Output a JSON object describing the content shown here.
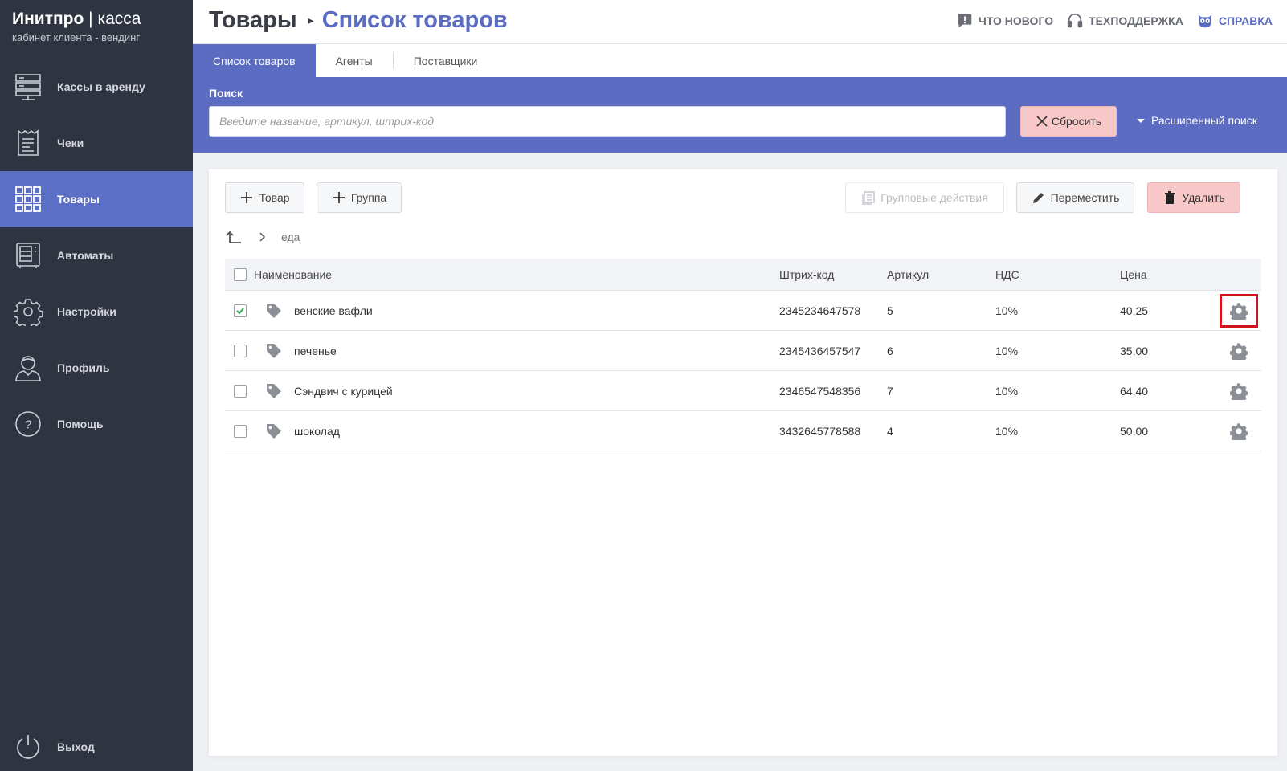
{
  "app": {
    "brand_bold": "Инитпро",
    "brand_sep": " | ",
    "brand_light": "касса",
    "subtitle": "кабинет клиента - вендинг"
  },
  "sidebar": {
    "items": [
      {
        "label": "Кассы в аренду",
        "icon": "server-icon"
      },
      {
        "label": "Чеки",
        "icon": "receipt-icon"
      },
      {
        "label": "Товары",
        "icon": "grid-icon"
      },
      {
        "label": "Автоматы",
        "icon": "vending-machine-icon"
      },
      {
        "label": "Настройки",
        "icon": "gear-icon"
      },
      {
        "label": "Профиль",
        "icon": "user-icon"
      },
      {
        "label": "Помощь",
        "icon": "question-icon"
      }
    ],
    "active_index": 2,
    "logout_label": "Выход"
  },
  "header": {
    "crumb_parent": "Товары",
    "crumb_current": "Список товаров",
    "links": {
      "whats_new": "ЧТО НОВОГО",
      "support": "ТЕХПОДДЕРЖКА",
      "help": "СПРАВКА"
    }
  },
  "tabs": {
    "items": [
      "Список товаров",
      "Агенты",
      "Поставщики"
    ],
    "active_index": 0
  },
  "search": {
    "label": "Поиск",
    "placeholder": "Введите название, артикул, штрих-код",
    "value": "",
    "reset_label": "Сбросить",
    "advanced_label": "Расширенный поиск"
  },
  "toolbar": {
    "add_product": "Товар",
    "add_group": "Группа",
    "group_actions": "Групповые действия",
    "move": "Переместить",
    "delete": "Удалить"
  },
  "path": {
    "current_folder": "еда"
  },
  "table": {
    "headers": {
      "name": "Наименование",
      "barcode": "Штрих-код",
      "article": "Артикул",
      "vat": "НДС",
      "price": "Цена"
    },
    "rows": [
      {
        "name": "венские вафли",
        "barcode": "2345234647578",
        "article": "5",
        "vat": "10%",
        "price": "40,25",
        "checked": true
      },
      {
        "name": "печенье",
        "barcode": "2345436457547",
        "article": "6",
        "vat": "10%",
        "price": "35,00",
        "checked": false
      },
      {
        "name": "Сэндвич с курицей",
        "barcode": "2346547548356",
        "article": "7",
        "vat": "10%",
        "price": "64,40",
        "checked": false
      },
      {
        "name": "шоколад",
        "barcode": "3432645778588",
        "article": "4",
        "vat": "10%",
        "price": "50,00",
        "checked": false
      }
    ]
  },
  "colors": {
    "sidebar_bg": "#2f3441",
    "accent": "#5b6cc2",
    "danger_bg": "#f8c7c8",
    "highlight": "#d0141e"
  }
}
